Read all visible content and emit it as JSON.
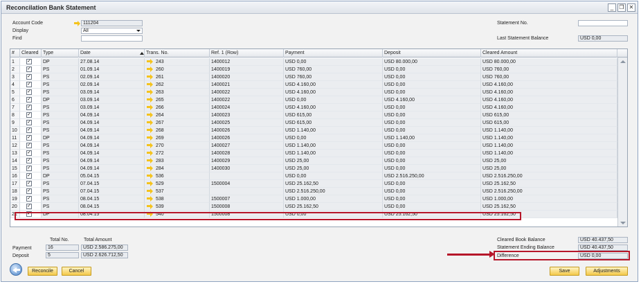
{
  "window": {
    "title": "Reconcilation Bank Statement",
    "min": "_",
    "max": "❐",
    "close": "✕"
  },
  "header": {
    "account_code_label": "Account Code",
    "account_code": "111204",
    "display_label": "Display",
    "display_value": "All",
    "find_label": "Find",
    "find_value": "",
    "statement_no_label": "Statement No.",
    "statement_no_value": "",
    "last_balance_label": "Last Statement Balance",
    "last_balance_value": "USD 0,00"
  },
  "table": {
    "columns": [
      "#",
      "Cleared",
      "Type",
      "Date",
      "Trans. No.",
      "Ref. 1 (Row)",
      "Payment",
      "Deposit",
      "Cleared Amount"
    ],
    "rows": [
      [
        "1",
        "DP",
        "27.08.14",
        "243",
        "1400012",
        "USD 0,00",
        "USD 80.000,00",
        "USD 80.000,00"
      ],
      [
        "2",
        "PS",
        "01.09.14",
        "260",
        "1400019",
        "USD 760,00",
        "USD 0,00",
        "USD 760,00"
      ],
      [
        "3",
        "PS",
        "02.09.14",
        "261",
        "1400020",
        "USD 760,00",
        "USD 0,00",
        "USD 760,00"
      ],
      [
        "4",
        "PS",
        "02.09.14",
        "262",
        "1400021",
        "USD 4.160,00",
        "USD 0,00",
        "USD 4.160,00"
      ],
      [
        "5",
        "PS",
        "03.09.14",
        "263",
        "1400022",
        "USD 4.160,00",
        "USD 0,00",
        "USD 4.160,00"
      ],
      [
        "6",
        "DP",
        "03.09.14",
        "265",
        "1400022",
        "USD 0,00",
        "USD 4.160,00",
        "USD 4.160,00"
      ],
      [
        "7",
        "PS",
        "03.09.14",
        "266",
        "1400024",
        "USD 4.160,00",
        "USD 0,00",
        "USD 4.160,00"
      ],
      [
        "8",
        "PS",
        "04.09.14",
        "264",
        "1400023",
        "USD 615,00",
        "USD 0,00",
        "USD 615,00"
      ],
      [
        "9",
        "PS",
        "04.09.14",
        "267",
        "1400025",
        "USD 615,00",
        "USD 0,00",
        "USD 615,00"
      ],
      [
        "10",
        "PS",
        "04.09.14",
        "268",
        "1400026",
        "USD 1.140,00",
        "USD 0,00",
        "USD 1.140,00"
      ],
      [
        "11",
        "DP",
        "04.09.14",
        "269",
        "1400026",
        "USD 0,00",
        "USD 1.140,00",
        "USD 1.140,00"
      ],
      [
        "12",
        "PS",
        "04.09.14",
        "270",
        "1400027",
        "USD 1.140,00",
        "USD 0,00",
        "USD 1.140,00"
      ],
      [
        "13",
        "PS",
        "04.09.14",
        "272",
        "1400028",
        "USD 1.140,00",
        "USD 0,00",
        "USD 1.140,00"
      ],
      [
        "14",
        "PS",
        "04.09.14",
        "283",
        "1400029",
        "USD 25,00",
        "USD 0,00",
        "USD 25,00"
      ],
      [
        "15",
        "PS",
        "04.09.14",
        "284",
        "1400030",
        "USD 25,00",
        "USD 0,00",
        "USD 25,00"
      ],
      [
        "16",
        "DP",
        "05.04.15",
        "536",
        "",
        "USD 0,00",
        "USD 2.516.250,00",
        "USD 2.516.250,00"
      ],
      [
        "17",
        "PS",
        "07.04.15",
        "529",
        "1500004",
        "USD 25.162,50",
        "USD 0,00",
        "USD 25.162,50"
      ],
      [
        "18",
        "PS",
        "07.04.15",
        "537",
        "",
        "USD 2.516.250,00",
        "USD 0,00",
        "USD 2.516.250,00"
      ],
      [
        "19",
        "PS",
        "08.04.15",
        "538",
        "1500007",
        "USD 1.000,00",
        "USD 0,00",
        "USD 1.000,00"
      ],
      [
        "20",
        "PS",
        "08.04.15",
        "539",
        "1500008",
        "USD 25.162,50",
        "USD 0,00",
        "USD 25.162,50"
      ],
      [
        "21",
        "DP",
        "08.04.15",
        "540",
        "1500008",
        "USD 0,00",
        "USD 25.162,50",
        "USD 25.162,50"
      ]
    ],
    "check_mark": "✓"
  },
  "totals": {
    "total_no_label": "Total No.",
    "total_amount_label": "Total Amount",
    "payment_label": "Payment",
    "payment_count": "16",
    "payment_amount": "USD 2.586.275,00",
    "deposit_label": "Deposit",
    "deposit_count": "5",
    "deposit_amount": "USD 2.626.712,50"
  },
  "balances": {
    "cleared_book_label": "Cleared Book Balance",
    "cleared_book_value": "USD 40.437,50",
    "ending_label": "Statement Ending Balance",
    "ending_value": "USD 40.437,50",
    "difference_label": "Difference",
    "difference_value": "USD 0,00"
  },
  "buttons": {
    "reconcile": "Reconcile",
    "cancel": "Cancel",
    "save": "Save",
    "adjustments": "Adjustments"
  },
  "colors": {
    "accent": "#f4c94a",
    "highlight": "#b6172a"
  }
}
